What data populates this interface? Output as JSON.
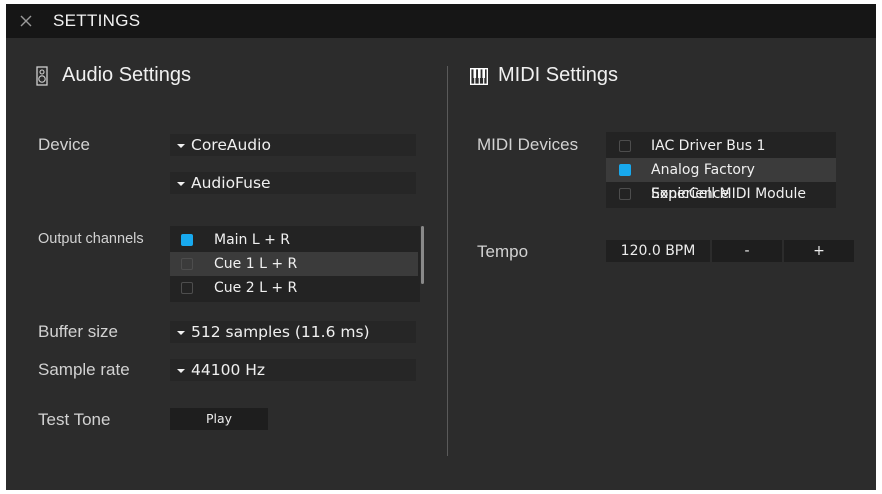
{
  "window": {
    "title": "SETTINGS"
  },
  "audio": {
    "heading": "Audio Settings",
    "device_label": "Device",
    "device_driver": "CoreAudio",
    "device_name": "AudioFuse",
    "output_label": "Output channels",
    "output_channels": [
      {
        "label": "Main L + R",
        "checked": true
      },
      {
        "label": "Cue 1 L + R",
        "checked": false
      },
      {
        "label": "Cue 2 L + R",
        "checked": false
      }
    ],
    "buffer_label": "Buffer size",
    "buffer_value": "512 samples (11.6 ms)",
    "rate_label": "Sample rate",
    "rate_value": "44100 Hz",
    "tone_label": "Test Tone",
    "tone_button": "Play"
  },
  "midi": {
    "heading": "MIDI Settings",
    "devices_label": "MIDI Devices",
    "devices": [
      {
        "label": "IAC Driver Bus 1",
        "checked": false
      },
      {
        "label": "Analog Factory Experience",
        "checked": true
      },
      {
        "label": "SonicCell MIDI Module",
        "checked": false
      }
    ],
    "tempo_label": "Tempo",
    "tempo_value": "120.0 BPM",
    "tempo_minus": "-",
    "tempo_plus": "+"
  },
  "colors": {
    "accent": "#18a9ee",
    "background": "#2c2c2c",
    "titlebar": "#161616"
  },
  "icons": {
    "close": "close-icon",
    "audio": "speaker-icon",
    "midi": "piano-keys-icon",
    "dropdown": "caret-down-icon"
  }
}
